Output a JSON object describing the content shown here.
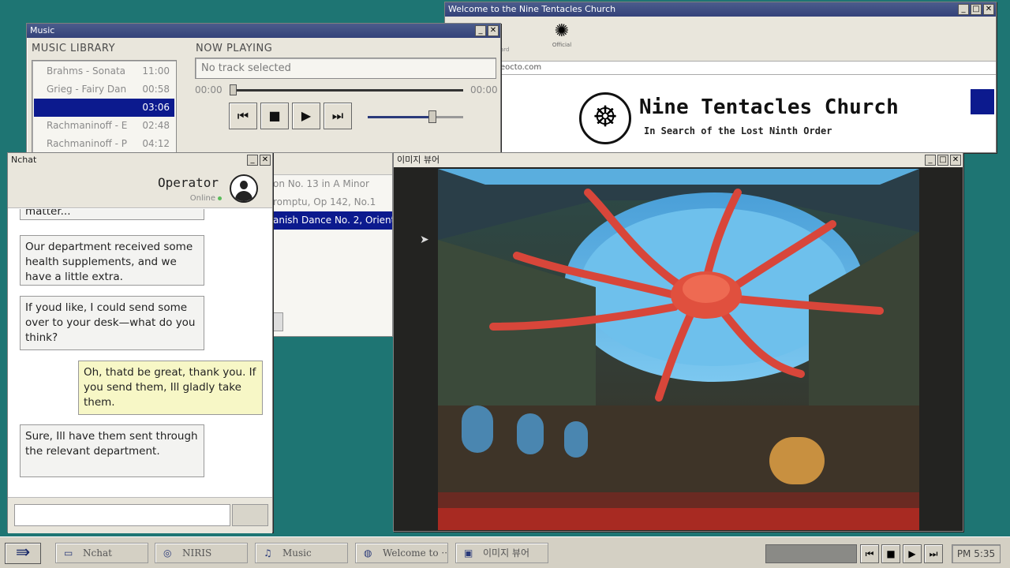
{
  "music": {
    "title": "Music",
    "library_title": "MUSIC LIBRARY",
    "tracks": [
      {
        "name": "Brahms - Sonata",
        "time": "11:00"
      },
      {
        "name": "Grieg - Fairy Dan",
        "time": "00:58"
      },
      {
        "name": "",
        "time": "03:06"
      },
      {
        "name": "Rachmaninoff - E",
        "time": "02:48"
      },
      {
        "name": "Rachmaninoff - P",
        "time": "04:12"
      }
    ],
    "now_playing_title": "NOW PLAYING",
    "now_playing": "No track selected",
    "time_start": "00:00",
    "time_end": "00:00",
    "volume": 0.7,
    "progress": 0
  },
  "playlist": {
    "items": [
      "on No. 13 in A Minor",
      "romptu, Op 142, No.1",
      "anish Dance No. 2, Orienta"
    ]
  },
  "browser": {
    "title": "Welcome to the Nine Tentacles Church",
    "back_label": "ard",
    "official_label": "Official",
    "url": "eocto.com",
    "site_name": "Nine Tentacles Church",
    "site_tagline": "In Search of the Lost Ninth Order"
  },
  "chat": {
    "title": "Nchat",
    "operator": "Operator",
    "status": "Online",
    "messages": [
      {
        "from": "them",
        "text": "matter..."
      },
      {
        "from": "them",
        "text": "Our department received some health supplements, and we have a little extra."
      },
      {
        "from": "them",
        "text": "If youd like, I could send some over to your desk—what do you think?"
      },
      {
        "from": "me",
        "text": "Oh, thatd be great, thank you. If you send them, Ill gladly take them."
      },
      {
        "from": "them",
        "text": "Sure, Ill have them sent through the relevant department."
      }
    ]
  },
  "viewer": {
    "title": "이미지 뷰어"
  },
  "taskbar": {
    "tasks": [
      {
        "label": "Nchat",
        "icon": "window-icon"
      },
      {
        "label": "NIRIS",
        "icon": "disc-icon"
      },
      {
        "label": "Music",
        "icon": "music-note-icon"
      },
      {
        "label": "Welcome to ···",
        "icon": "globe-icon"
      },
      {
        "label": "이미지 뷰어",
        "icon": "image-icon"
      }
    ],
    "clock": "PM 5:35"
  },
  "colors": {
    "desktop": "#1e7573",
    "selection": "#0c1a8e",
    "titlebar": "#34427a",
    "my_bubble": "#f7f7c6"
  }
}
